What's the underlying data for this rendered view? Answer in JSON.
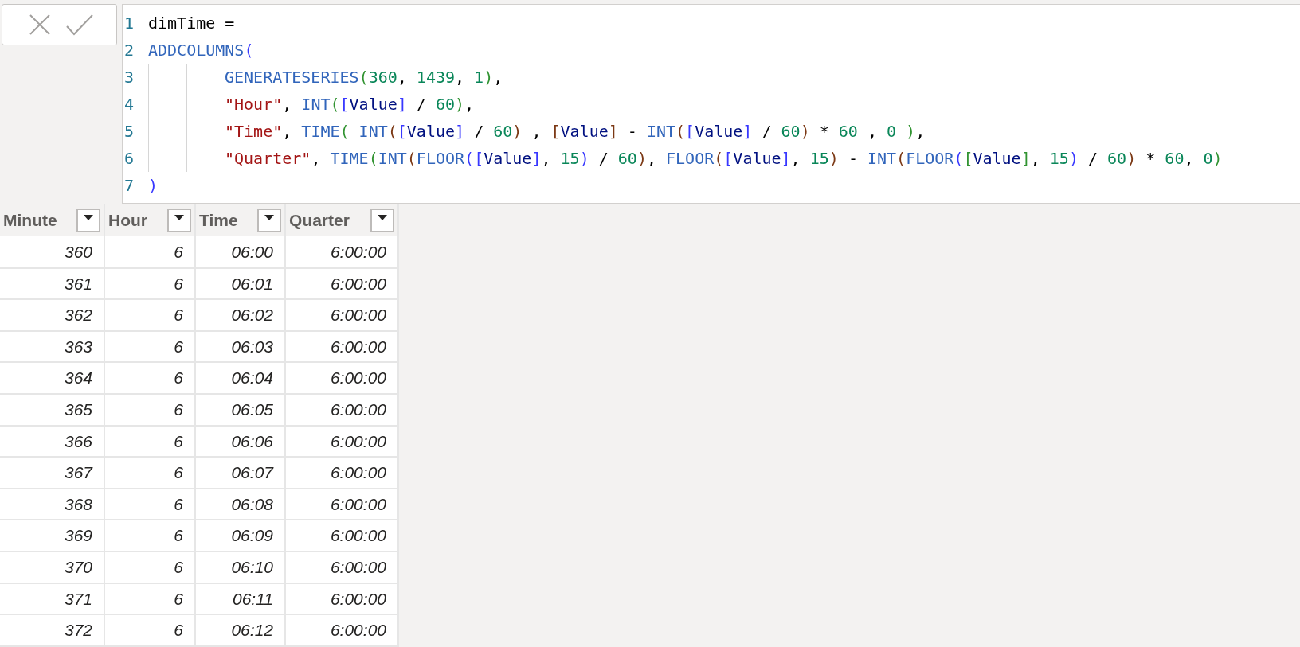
{
  "formula_bar": {
    "lines": [
      {
        "number": "1",
        "indented": false,
        "tokens": [
          {
            "kind": "plain",
            "text": "dimTime ="
          }
        ]
      },
      {
        "number": "2",
        "indented": false,
        "tokens": [
          {
            "kind": "func",
            "text": "ADDCOLUMNS"
          },
          {
            "kind": "paren1",
            "text": "("
          }
        ]
      },
      {
        "number": "3",
        "indented": true,
        "tokens": [
          {
            "kind": "func",
            "text": "GENERATESERIES"
          },
          {
            "kind": "paren2",
            "text": "("
          },
          {
            "kind": "number",
            "text": "360"
          },
          {
            "kind": "plain",
            "text": ", "
          },
          {
            "kind": "number",
            "text": "1439"
          },
          {
            "kind": "plain",
            "text": ", "
          },
          {
            "kind": "number",
            "text": "1"
          },
          {
            "kind": "paren2",
            "text": ")"
          },
          {
            "kind": "plain",
            "text": ","
          }
        ]
      },
      {
        "number": "4",
        "indented": true,
        "tokens": [
          {
            "kind": "string",
            "text": "\"Hour\""
          },
          {
            "kind": "plain",
            "text": ", "
          },
          {
            "kind": "func",
            "text": "INT"
          },
          {
            "kind": "paren2",
            "text": "("
          },
          {
            "kind": "paren1",
            "text": "["
          },
          {
            "kind": "column",
            "text": "Value"
          },
          {
            "kind": "paren1",
            "text": "]"
          },
          {
            "kind": "plain",
            "text": " / "
          },
          {
            "kind": "number",
            "text": "60"
          },
          {
            "kind": "paren2",
            "text": ")"
          },
          {
            "kind": "plain",
            "text": ","
          }
        ]
      },
      {
        "number": "5",
        "indented": true,
        "tokens": [
          {
            "kind": "string",
            "text": "\"Time\""
          },
          {
            "kind": "plain",
            "text": ", "
          },
          {
            "kind": "func",
            "text": "TIME"
          },
          {
            "kind": "paren2",
            "text": "( "
          },
          {
            "kind": "func",
            "text": "INT"
          },
          {
            "kind": "paren3",
            "text": "("
          },
          {
            "kind": "paren1",
            "text": "["
          },
          {
            "kind": "column",
            "text": "Value"
          },
          {
            "kind": "paren1",
            "text": "]"
          },
          {
            "kind": "plain",
            "text": " / "
          },
          {
            "kind": "number",
            "text": "60"
          },
          {
            "kind": "paren3",
            "text": ")"
          },
          {
            "kind": "plain",
            "text": " , "
          },
          {
            "kind": "paren3",
            "text": "["
          },
          {
            "kind": "column",
            "text": "Value"
          },
          {
            "kind": "paren3",
            "text": "]"
          },
          {
            "kind": "plain",
            "text": " - "
          },
          {
            "kind": "func",
            "text": "INT"
          },
          {
            "kind": "paren3",
            "text": "("
          },
          {
            "kind": "paren1",
            "text": "["
          },
          {
            "kind": "column",
            "text": "Value"
          },
          {
            "kind": "paren1",
            "text": "]"
          },
          {
            "kind": "plain",
            "text": " / "
          },
          {
            "kind": "number",
            "text": "60"
          },
          {
            "kind": "paren3",
            "text": ")"
          },
          {
            "kind": "plain",
            "text": " * "
          },
          {
            "kind": "number",
            "text": "60"
          },
          {
            "kind": "plain",
            "text": " , "
          },
          {
            "kind": "number",
            "text": "0 "
          },
          {
            "kind": "paren2",
            "text": ")"
          },
          {
            "kind": "plain",
            "text": ","
          }
        ]
      },
      {
        "number": "6",
        "indented": true,
        "tokens": [
          {
            "kind": "string",
            "text": "\"Quarter\""
          },
          {
            "kind": "plain",
            "text": ", "
          },
          {
            "kind": "func",
            "text": "TIME"
          },
          {
            "kind": "paren2",
            "text": "("
          },
          {
            "kind": "func",
            "text": "INT"
          },
          {
            "kind": "paren3",
            "text": "("
          },
          {
            "kind": "func",
            "text": "FLOOR"
          },
          {
            "kind": "paren1",
            "text": "("
          },
          {
            "kind": "paren1",
            "text": "["
          },
          {
            "kind": "column",
            "text": "Value"
          },
          {
            "kind": "paren1",
            "text": "]"
          },
          {
            "kind": "plain",
            "text": ", "
          },
          {
            "kind": "number",
            "text": "15"
          },
          {
            "kind": "paren1",
            "text": ")"
          },
          {
            "kind": "plain",
            "text": " / "
          },
          {
            "kind": "number",
            "text": "60"
          },
          {
            "kind": "paren3",
            "text": ")"
          },
          {
            "kind": "plain",
            "text": ", "
          },
          {
            "kind": "func",
            "text": "FLOOR"
          },
          {
            "kind": "paren3",
            "text": "("
          },
          {
            "kind": "paren1",
            "text": "["
          },
          {
            "kind": "column",
            "text": "Value"
          },
          {
            "kind": "paren1",
            "text": "]"
          },
          {
            "kind": "plain",
            "text": ", "
          },
          {
            "kind": "number",
            "text": "15"
          },
          {
            "kind": "paren3",
            "text": ")"
          },
          {
            "kind": "plain",
            "text": " - "
          },
          {
            "kind": "func",
            "text": "INT"
          },
          {
            "kind": "paren3",
            "text": "("
          },
          {
            "kind": "func",
            "text": "FLOOR"
          },
          {
            "kind": "paren1",
            "text": "("
          },
          {
            "kind": "paren2",
            "text": "["
          },
          {
            "kind": "column",
            "text": "Value"
          },
          {
            "kind": "paren2",
            "text": "]"
          },
          {
            "kind": "plain",
            "text": ", "
          },
          {
            "kind": "number",
            "text": "15"
          },
          {
            "kind": "paren1",
            "text": ")"
          },
          {
            "kind": "plain",
            "text": " / "
          },
          {
            "kind": "number",
            "text": "60"
          },
          {
            "kind": "paren3",
            "text": ")"
          },
          {
            "kind": "plain",
            "text": " * "
          },
          {
            "kind": "number",
            "text": "60"
          },
          {
            "kind": "plain",
            "text": ", "
          },
          {
            "kind": "number",
            "text": "0"
          },
          {
            "kind": "paren2",
            "text": ")"
          }
        ]
      },
      {
        "number": "7",
        "indented": false,
        "tokens": [
          {
            "kind": "paren1",
            "text": ")"
          }
        ]
      }
    ]
  },
  "table": {
    "columns": [
      "Minute",
      "Hour",
      "Time",
      "Quarter"
    ],
    "rows": [
      [
        "360",
        "6",
        "06:00",
        "6:00:00"
      ],
      [
        "361",
        "6",
        "06:01",
        "6:00:00"
      ],
      [
        "362",
        "6",
        "06:02",
        "6:00:00"
      ],
      [
        "363",
        "6",
        "06:03",
        "6:00:00"
      ],
      [
        "364",
        "6",
        "06:04",
        "6:00:00"
      ],
      [
        "365",
        "6",
        "06:05",
        "6:00:00"
      ],
      [
        "366",
        "6",
        "06:06",
        "6:00:00"
      ],
      [
        "367",
        "6",
        "06:07",
        "6:00:00"
      ],
      [
        "368",
        "6",
        "06:08",
        "6:00:00"
      ],
      [
        "369",
        "6",
        "06:09",
        "6:00:00"
      ],
      [
        "370",
        "6",
        "06:10",
        "6:00:00"
      ],
      [
        "371",
        "6",
        "06:11",
        "6:00:00"
      ],
      [
        "372",
        "6",
        "06:12",
        "6:00:00"
      ]
    ]
  }
}
